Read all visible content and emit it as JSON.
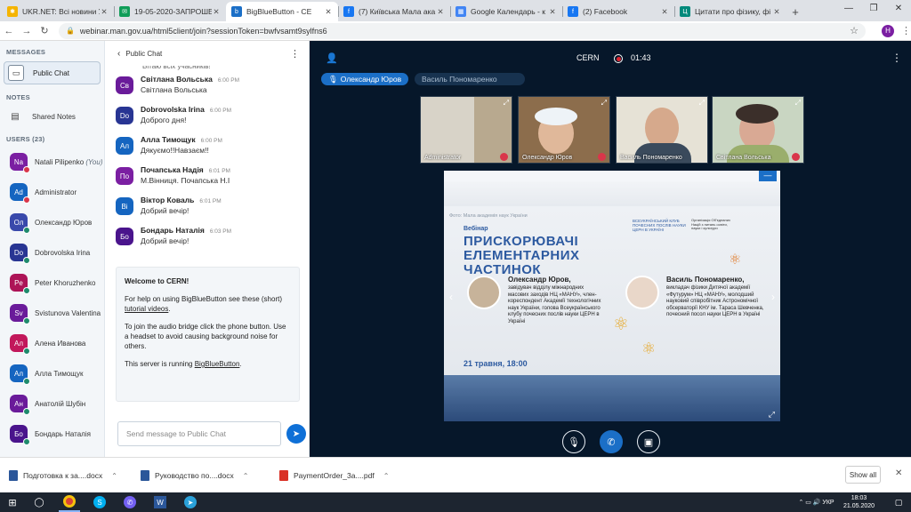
{
  "browser": {
    "tabs": [
      {
        "title": "UKR.NET: Всі новини Укр",
        "fav_color": "#f5b400",
        "fav_glyph": "✱"
      },
      {
        "title": "19-05-2020-ЗАПРОШЕ",
        "fav_color": "#0f9d58",
        "fav_glyph": "✉"
      },
      {
        "title": "BigBlueButton - CE",
        "fav_color": "#1b6fc7",
        "fav_glyph": "b",
        "active": true
      },
      {
        "title": "(7) Київська Мала ака",
        "fav_color": "#1877f2",
        "fav_glyph": "f"
      },
      {
        "title": "Google Календарь - к",
        "fav_color": "#4285f4",
        "fav_glyph": "▦"
      },
      {
        "title": "(2) Facebook",
        "fav_color": "#1877f2",
        "fav_glyph": "f"
      },
      {
        "title": "Цитати про фізику, фі",
        "fav_color": "#00897b",
        "fav_glyph": "Ц"
      }
    ],
    "url": "webinar.man.gov.ua/html5client/join?sessionToken=bwfvsamt9sylfns6",
    "profile_initial": "H"
  },
  "sidebar": {
    "messages_heading": "MESSAGES",
    "public_chat_label": "Public Chat",
    "notes_heading": "NOTES",
    "shared_notes_label": "Shared Notes",
    "users_heading": "USERS (23)",
    "users": [
      {
        "initials": "Na",
        "name": "Natali Pilipenko",
        "suffix": "(You)",
        "color": "#7b1fa2",
        "mic": "red"
      },
      {
        "initials": "Ad",
        "name": "Administrator",
        "suffix": "",
        "color": "#1565c0",
        "mic": "red"
      },
      {
        "initials": "Ол",
        "name": "Олександр Юров",
        "suffix": "",
        "color": "#3949ab",
        "mic": "green"
      },
      {
        "initials": "Do",
        "name": "Dobrovolska Irina",
        "suffix": "",
        "color": "#283593",
        "mic": "green"
      },
      {
        "initials": "Pe",
        "name": "Peter Khoruzhenko",
        "suffix": "",
        "color": "#ad1457",
        "mic": "green"
      },
      {
        "initials": "Sv",
        "name": "Svistunova Valentina",
        "suffix": "",
        "color": "#6a1b9a",
        "mic": "green"
      },
      {
        "initials": "Ал",
        "name": "Алена Иванова",
        "suffix": "",
        "color": "#c2185b",
        "mic": "green"
      },
      {
        "initials": "Ал",
        "name": "Алла Тимощук",
        "suffix": "",
        "color": "#1565c0",
        "mic": "green"
      },
      {
        "initials": "Ан",
        "name": "Анатолій Шубін",
        "suffix": "",
        "color": "#6a1b9a",
        "mic": "green"
      },
      {
        "initials": "Бо",
        "name": "Бондарь Наталія",
        "suffix": "",
        "color": "#4a148c",
        "mic": "green"
      }
    ]
  },
  "chat": {
    "header": "Public Chat",
    "partial_line": "Вітаю всіх учасників!",
    "messages": [
      {
        "initials": "Св",
        "name": "Світлана Вольська",
        "time": "6:00 PM",
        "text": "Світлана Вольська",
        "color": "#6a1b9a"
      },
      {
        "initials": "Do",
        "name": "Dobrovolska Irina",
        "time": "6:00 PM",
        "text": "Доброго дня!",
        "color": "#283593"
      },
      {
        "initials": "Ал",
        "name": "Алла Тимощук",
        "time": "6:00 PM",
        "text": "Дякуємо!!Навзаєм!!",
        "color": "#1565c0"
      },
      {
        "initials": "По",
        "name": "Почапська Надія",
        "time": "6:01 PM",
        "text": "М.Вінниця. Почапська Н.І",
        "color": "#7b1fa2"
      },
      {
        "initials": "Ві",
        "name": "Віктор Коваль",
        "time": "6:01 PM",
        "text": "Добрий вечір!",
        "color": "#1565c0"
      },
      {
        "initials": "Бо",
        "name": "Бондарь Наталія",
        "time": "6:03 PM",
        "text": "Добрий вечір!",
        "color": "#4a148c"
      }
    ],
    "welcome": {
      "title": "Welcome to CERN!",
      "help_prefix": "For help on using BigBlueButton see these (short) ",
      "help_link": "tutorial videos",
      "help_suffix": ".",
      "audio": "To join the audio bridge click the phone button. Use a headset to avoid causing background noise for others.",
      "running_prefix": "This server is running ",
      "running_link": "BigBlueButton",
      "running_suffix": "."
    },
    "input_placeholder": "Send message to Public Chat"
  },
  "meeting": {
    "title": "CERN",
    "elapsed": "01:43",
    "talking": [
      "Олександр Юров",
      "Василь Пономаренко"
    ],
    "webcams": [
      {
        "label": "Administrator"
      },
      {
        "label": "Олександр Юров"
      },
      {
        "label": "Василь Пономаренко"
      },
      {
        "label": "Світлана Вольська"
      }
    ]
  },
  "slide": {
    "photo_archive": "Фото: Мала академія наук України",
    "webinar": "Вебінар",
    "title": "ПРИСКОРЮВАЧІ ЕЛЕМЕНТАРНИХ ЧАСТИНОК",
    "club": "ВСЕУКРАЇНСЬКИЙ КЛУБ ПОЧЕСНИХ ПОСЛІВ НАУКИ ЦЕРН В УКРАЇНІ",
    "unesco": "Організація Об'єднаних Націй з питань освіти, науки і культури",
    "speaker1_name": "Олександр Юров,",
    "speaker1_desc": "завідувач відділу міжнародних масових заходів НЦ «МАНУ», член-кореспондент Академії технологічних наук України, голова Всеукраїнського клубу почесних послів науки ЦЕРН в Україні",
    "speaker2_name": "Василь Пономаренко,",
    "speaker2_desc": "викладач фізики Дитячої академії «Футурум» НЦ «МАНУ», молодший науковий співробітник Астрономічної обсерваторії КНУ ім. Тараса Шевченка, почесний посол науки ЦЕРН в Україні",
    "date": "21 травня, 18:00"
  },
  "downloads": {
    "items": [
      {
        "name": "Подготовка к за....docx",
        "color": "#2b579a"
      },
      {
        "name": "Руководство по....docx",
        "color": "#2b579a"
      },
      {
        "name": "PaymentOrder_3a....pdf",
        "color": "#d93025"
      }
    ],
    "show_all": "Show all"
  },
  "taskbar": {
    "lang": "УКР",
    "time": "18:03",
    "date": "21.05.2020"
  }
}
